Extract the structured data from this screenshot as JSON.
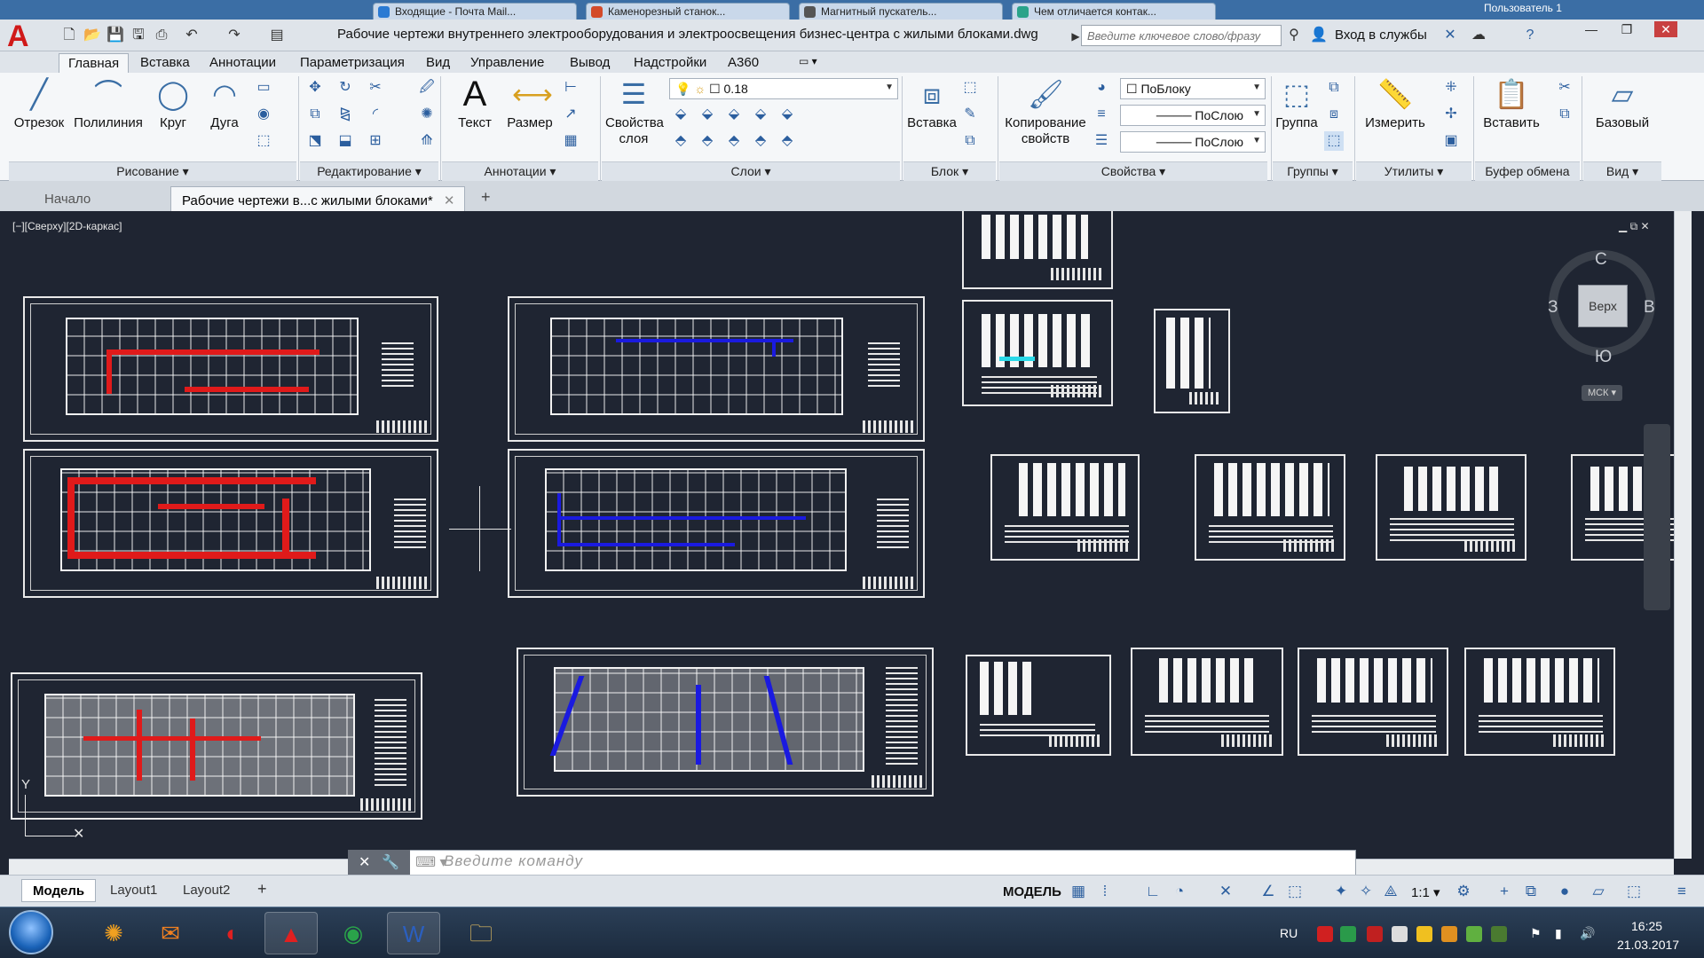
{
  "browser_tabs": [
    {
      "label": "Входящие - Почта Mail...",
      "color": "#2a7ad3"
    },
    {
      "label": "Каменорезный станок...",
      "color": "#d34a2a"
    },
    {
      "label": "Магнитный пускатель...",
      "color": "#555555"
    },
    {
      "label": "Чем отличается контак...",
      "color": "#2aa38a"
    }
  ],
  "user_label": "Пользователь 1",
  "titlebar": {
    "app_icon": "autocad-logo-icon",
    "doc_title": "Рабочие чертежи внутреннего электрооборудования и электроосвещения бизнес-центра с жилыми блоками.dwg",
    "search_placeholder": "Введите ключевое слово/фразу",
    "signin_label": "Вход в службы",
    "help_icon": "help-icon"
  },
  "ribbon_tabs": [
    "Главная",
    "Вставка",
    "Аннотации",
    "Параметризация",
    "Вид",
    "Управление",
    "Вывод",
    "Надстройки",
    "A360"
  ],
  "ribbon_active_tab": "Главная",
  "ribbon": {
    "draw": {
      "line": "Отрезок",
      "polyline": "Полилиния",
      "circle": "Круг",
      "arc": "Дуга",
      "footer": "Рисование ▾"
    },
    "modify": {
      "footer": "Редактирование ▾"
    },
    "annotation": {
      "text": "Текст",
      "dimension": "Размер",
      "footer": "Аннотации ▾"
    },
    "layers": {
      "properties_line1": "Свойства",
      "properties_line2": "слоя",
      "current_layer": "0.18",
      "footer": "Слои ▾"
    },
    "block": {
      "insert": "Вставка",
      "footer": "Блок ▾"
    },
    "properties": {
      "copy_line1": "Копирование",
      "copy_line2": "свойств",
      "color": "ПоБлоку",
      "linetype": "ПоСлою",
      "lineweight": "ПоСлою",
      "footer": "Свойства ▾"
    },
    "groups": {
      "group": "Группа",
      "footer": "Группы ▾"
    },
    "utilities": {
      "measure": "Измерить",
      "footer": "Утилиты ▾"
    },
    "clipboard": {
      "paste": "Вставить",
      "footer": "Буфер обмена"
    },
    "view": {
      "base": "Базовый",
      "footer": "Вид ▾"
    }
  },
  "file_tabs": [
    {
      "label": "Начало",
      "active": false
    },
    {
      "label": "Рабочие чертежи в...с жилыми блоками*",
      "active": true
    }
  ],
  "viewport": {
    "label": "[−][Сверху][2D-каркас]",
    "viewcube_face": "Верх",
    "north": "С",
    "south": "Ю",
    "west": "З",
    "east": "В",
    "ucs": "МСК"
  },
  "command_placeholder": "Введите команду",
  "layout_tabs": [
    {
      "label": "Модель",
      "active": true
    },
    {
      "label": "Layout1",
      "active": false
    },
    {
      "label": "Layout2",
      "active": false
    }
  ],
  "status": {
    "mode": "МОДЕЛЬ",
    "scale": "1:1"
  },
  "taskbar": {
    "lang": "RU",
    "time": "16:25",
    "date": "21.03.2017"
  },
  "colors": {
    "wire_red": "#e01a1a",
    "wire_blue": "#1a1ae0",
    "canvas": "#1f2532",
    "cyan": "#2ad9e8"
  }
}
